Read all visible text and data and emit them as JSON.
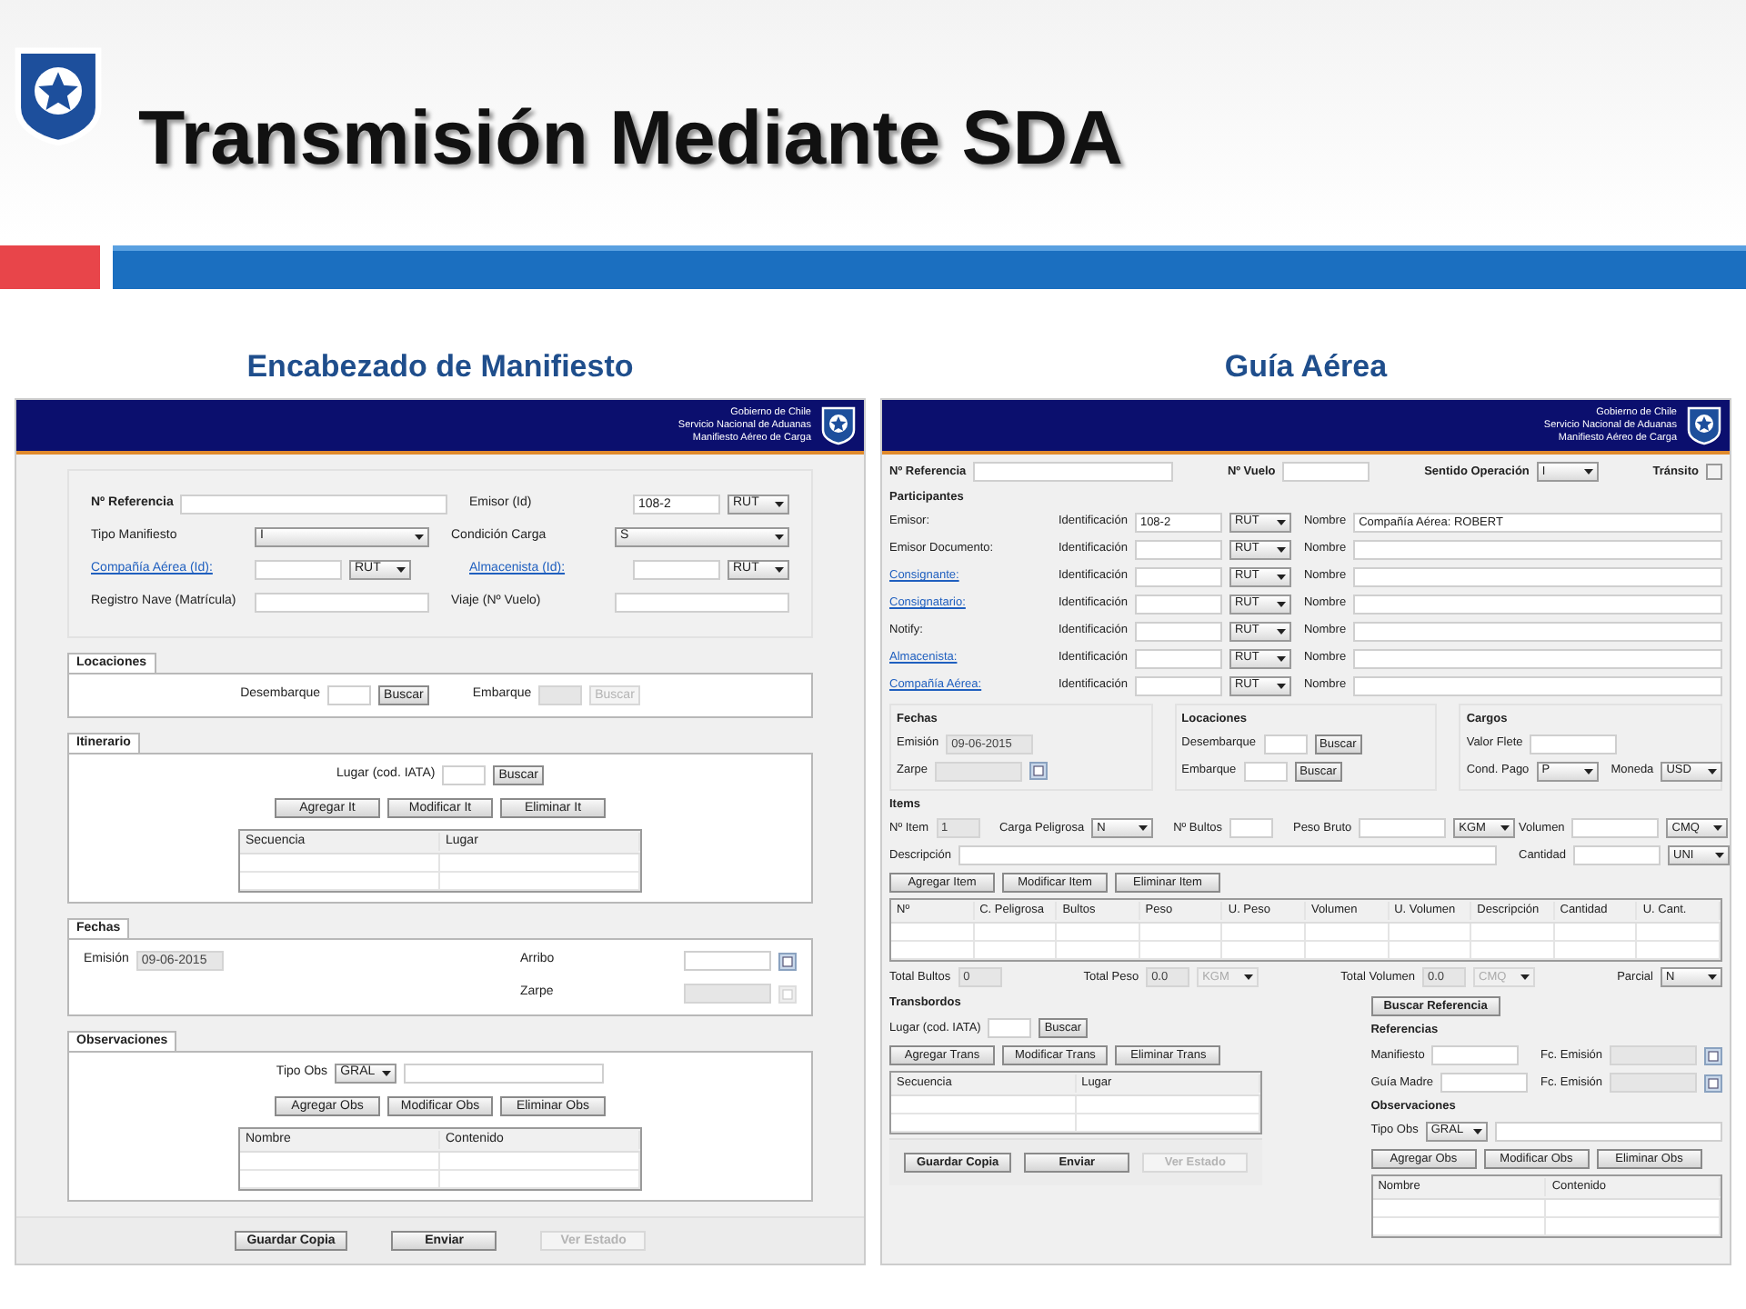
{
  "slide": {
    "title": "Transmisión Mediante SDA"
  },
  "panels": [
    {
      "caption": "Encabezado de Manifiesto",
      "banner": [
        "Gobierno de Chile",
        "Servicio Nacional de Aduanas",
        "Manifiesto Aéreo de Carga"
      ],
      "sections": [
        {
          "kind": "box",
          "rows": [
            [
              [
                {
                  "kind": "bold",
                  "text": "Nº Referencia"
                },
                {
                  "kind": "wide"
                }
              ],
              [
                {
                  "kind": "label",
                  "text": "Emisor (Id)"
                },
                {
                  "kind": "input",
                  "value": "108-2"
                },
                {
                  "kind": "select",
                  "value": "RUT"
                }
              ]
            ],
            [
              [
                {
                  "kind": "label",
                  "text": "Tipo Manifiesto"
                },
                {
                  "kind": "combo",
                  "value": "I"
                }
              ],
              [
                {
                  "kind": "label",
                  "text": "Condición Carga"
                },
                {
                  "kind": "combo",
                  "value": "S"
                }
              ]
            ],
            [
              [
                {
                  "kind": "link",
                  "text": "Compañía Aérea (Id):"
                },
                {
                  "kind": "input"
                },
                {
                  "kind": "select",
                  "value": "RUT"
                }
              ],
              [
                {
                  "kind": "link",
                  "text": "Almacenista (Id):"
                },
                {
                  "kind": "input"
                },
                {
                  "kind": "select",
                  "value": "RUT"
                }
              ]
            ],
            [
              [
                {
                  "kind": "label",
                  "text": "Registro Nave (Matrícula)"
                },
                {
                  "kind": "wide"
                }
              ],
              [
                {
                  "kind": "label",
                  "text": "Viaje (Nº Vuelo)"
                },
                {
                  "kind": "wide"
                }
              ]
            ]
          ]
        },
        {
          "kind": "tab",
          "title": "Locaciones",
          "rows": [
            [
              [
                {
                  "kind": "text",
                  "text": "Desembarque"
                },
                {
                  "kind": "short",
                  "disabled": false
                },
                {
                  "kind": "button",
                  "text": "Buscar",
                  "disabled": false
                }
              ],
              [
                {
                  "kind": "text",
                  "text": "Embarque"
                },
                {
                  "kind": "short",
                  "disabled": true
                },
                {
                  "kind": "button",
                  "text": "Buscar",
                  "disabled": true
                }
              ]
            ]
          ]
        },
        {
          "kind": "tab",
          "title": "Itinerario",
          "rows": [
            [
              [
                {
                  "kind": "text",
                  "text": "Lugar (cod. IATA)"
                },
                {
                  "kind": "short"
                },
                {
                  "kind": "button",
                  "text": "Buscar",
                  "disabled": false
                }
              ]
            ],
            [
              [
                {
                  "kind": "action",
                  "text": "Agregar It",
                  "disabled": false
                },
                {
                  "kind": "action",
                  "text": "Modificar It",
                  "disabled": false
                },
                {
                  "kind": "action",
                  "text": "Eliminar It",
                  "disabled": false
                }
              ]
            ]
          ],
          "table": {
            "columns": [
              "Secuencia",
              "Lugar"
            ]
          }
        },
        {
          "kind": "tab",
          "title": "Fechas",
          "parts": [
            {
              "kind": "plain",
              "rows": [
                [
                  [
                    {
                      "kind": "text",
                      "text": "Emisión"
                    },
                    {
                      "kind": "input",
                      "value": "09-06-2015",
                      "disabled": true
                    }
                  ]
                ]
              ]
            },
            {
              "kind": "plain",
              "rows": [
                [
                  [
                    {
                      "kind": "label",
                      "text": "Arribo"
                    },
                    {
                      "kind": "input",
                      "disabled": false
                    },
                    {
                      "kind": "date",
                      "disabled": false
                    }
                  ]
                ],
                [
                  [
                    {
                      "kind": "label",
                      "text": "Zarpe"
                    },
                    {
                      "kind": "input",
                      "disabled": true
                    },
                    {
                      "kind": "date",
                      "disabled": true
                    }
                  ]
                ]
              ]
            }
          ]
        },
        {
          "kind": "tab",
          "title": "Observaciones",
          "rows": [
            [
              [
                {
                  "kind": "text",
                  "text": "Tipo Obs"
                },
                {
                  "kind": "select",
                  "value": "GRAL"
                },
                {
                  "kind": "long"
                }
              ]
            ],
            [
              [
                {
                  "kind": "action",
                  "text": "Agregar Obs",
                  "disabled": false
                },
                {
                  "kind": "action",
                  "text": "Modificar Obs",
                  "disabled": false
                },
                {
                  "kind": "action",
                  "text": "Eliminar Obs",
                  "disabled": false
                }
              ]
            ]
          ],
          "table": {
            "columns": [
              "Nombre",
              "Contenido"
            ]
          }
        },
        {
          "kind": "footer",
          "rows": [
            [
              [
                {
                  "kind": "action",
                  "text": "Guardar Copia",
                  "bold": true,
                  "disabled": false
                }
              ],
              [
                {
                  "kind": "action",
                  "text": "Enviar",
                  "bold": true,
                  "disabled": false
                }
              ],
              [
                {
                  "kind": "action",
                  "text": "Ver Estado",
                  "bold": true,
                  "disabled": true
                }
              ]
            ]
          ]
        }
      ]
    },
    {
      "caption": "Guía Aérea",
      "banner": [
        "Gobierno de Chile",
        "Servicio Nacional de Aduanas",
        "Manifiesto Aéreo de Carga"
      ],
      "sections": [
        {
          "kind": "plain",
          "rows": [
            [
              [
                {
                  "kind": "bold",
                  "text": "Nº Referencia"
                },
                {
                  "kind": "long"
                }
              ],
              [
                {
                  "kind": "bold",
                  "text": "Nº Vuelo"
                },
                {
                  "kind": "input"
                }
              ],
              [
                {
                  "kind": "bold",
                  "text": "Sentido Operación"
                },
                {
                  "kind": "select",
                  "value": "I"
                }
              ],
              [
                {
                  "kind": "bold",
                  "text": "Tránsito"
                },
                {
                  "kind": "checkbox",
                  "checked": false
                }
              ]
            ]
          ]
        },
        {
          "kind": "heading",
          "title": "Participantes",
          "rows": [
            [
              [
                {
                  "kind": "label",
                  "text": "Emisor:"
                }
              ],
              [
                {
                  "kind": "text",
                  "text": "Identificación"
                },
                {
                  "kind": "input",
                  "value": "108-2"
                },
                {
                  "kind": "select",
                  "value": "RUT"
                }
              ],
              [
                {
                  "kind": "text",
                  "text": "Nombre"
                },
                {
                  "kind": "wide",
                  "value": "Compañía Aérea: ROBERT"
                }
              ]
            ],
            [
              [
                {
                  "kind": "label",
                  "text": "Emisor Documento:"
                }
              ],
              [
                {
                  "kind": "text",
                  "text": "Identificación"
                },
                {
                  "kind": "input"
                },
                {
                  "kind": "select",
                  "value": "RUT"
                }
              ],
              [
                {
                  "kind": "text",
                  "text": "Nombre"
                },
                {
                  "kind": "wide"
                }
              ]
            ],
            [
              [
                {
                  "kind": "link",
                  "text": "Consignante:"
                }
              ],
              [
                {
                  "kind": "text",
                  "text": "Identificación"
                },
                {
                  "kind": "input"
                },
                {
                  "kind": "select",
                  "value": "RUT"
                }
              ],
              [
                {
                  "kind": "text",
                  "text": "Nombre"
                },
                {
                  "kind": "wide"
                }
              ]
            ],
            [
              [
                {
                  "kind": "link",
                  "text": "Consignatario:"
                }
              ],
              [
                {
                  "kind": "text",
                  "text": "Identificación"
                },
                {
                  "kind": "input"
                },
                {
                  "kind": "select",
                  "value": "RUT"
                }
              ],
              [
                {
                  "kind": "text",
                  "text": "Nombre"
                },
                {
                  "kind": "wide"
                }
              ]
            ],
            [
              [
                {
                  "kind": "label",
                  "text": "Notify:"
                }
              ],
              [
                {
                  "kind": "text",
                  "text": "Identificación"
                },
                {
                  "kind": "input"
                },
                {
                  "kind": "select",
                  "value": "RUT"
                }
              ],
              [
                {
                  "kind": "text",
                  "text": "Nombre"
                },
                {
                  "kind": "wide"
                }
              ]
            ],
            [
              [
                {
                  "kind": "link",
                  "text": "Almacenista:"
                }
              ],
              [
                {
                  "kind": "text",
                  "text": "Identificación"
                },
                {
                  "kind": "input"
                },
                {
                  "kind": "select",
                  "value": "RUT"
                }
              ],
              [
                {
                  "kind": "text",
                  "text": "Nombre"
                },
                {
                  "kind": "wide"
                }
              ]
            ],
            [
              [
                {
                  "kind": "link",
                  "text": "Compañía Aérea:"
                }
              ],
              [
                {
                  "kind": "text",
                  "text": "Identificación"
                },
                {
                  "kind": "input"
                },
                {
                  "kind": "select",
                  "value": "RUT"
                }
              ],
              [
                {
                  "kind": "text",
                  "text": "Nombre"
                },
                {
                  "kind": "wide"
                }
              ]
            ]
          ]
        },
        {
          "kind": "plain",
          "parts": [
            {
              "kind": "heading",
              "title": "Fechas",
              "rows": [
                [
                  [
                    {
                      "kind": "text",
                      "text": "Emisión"
                    },
                    {
                      "kind": "input",
                      "value": "09-06-2015",
                      "disabled": true
                    }
                  ]
                ],
                [
                  [
                    {
                      "kind": "text",
                      "text": "Zarpe"
                    },
                    {
                      "kind": "input",
                      "disabled": true
                    },
                    {
                      "kind": "date",
                      "disabled": false
                    }
                  ]
                ]
              ]
            },
            {
              "kind": "heading",
              "title": "Locaciones",
              "rows": [
                [
                  [
                    {
                      "kind": "text",
                      "text": "Desembarque"
                    },
                    {
                      "kind": "short"
                    },
                    {
                      "kind": "button",
                      "text": "Buscar",
                      "disabled": false
                    }
                  ]
                ],
                [
                  [
                    {
                      "kind": "text",
                      "text": "Embarque"
                    },
                    {
                      "kind": "short"
                    },
                    {
                      "kind": "button",
                      "text": "Buscar",
                      "disabled": false
                    }
                  ]
                ]
              ]
            },
            {
              "kind": "heading",
              "title": "Cargos",
              "rows": [
                [
                  [
                    {
                      "kind": "text",
                      "text": "Valor Flete"
                    },
                    {
                      "kind": "input"
                    }
                  ]
                ],
                [
                  [
                    {
                      "kind": "text",
                      "text": "Cond. Pago"
                    },
                    {
                      "kind": "select",
                      "value": "P"
                    }
                  ],
                  [
                    {
                      "kind": "text",
                      "text": "Moneda"
                    },
                    {
                      "kind": "select",
                      "value": "USD"
                    }
                  ]
                ]
              ]
            }
          ]
        },
        {
          "kind": "heading",
          "title": "Items",
          "parts": [
            {
              "kind": "plain",
              "rows": [
                [
                  [
                    {
                      "kind": "text",
                      "text": "Nº Item"
                    },
                    {
                      "kind": "short",
                      "value": "1",
                      "disabled": true
                    }
                  ],
                  [
                    {
                      "kind": "text",
                      "text": "Carga Peligrosa"
                    },
                    {
                      "kind": "select",
                      "value": "N"
                    }
                  ],
                  [
                    {
                      "kind": "text",
                      "text": "Nº Bultos"
                    },
                    {
                      "kind": "short"
                    }
                  ],
                  [
                    {
                      "kind": "text",
                      "text": "Peso Bruto"
                    },
                    {
                      "kind": "input"
                    },
                    {
                      "kind": "select",
                      "value": "KGM"
                    }
                  ]
                ],
                [
                  [
                    {
                      "kind": "text",
                      "text": "Descripción"
                    },
                    {
                      "kind": "wide"
                    }
                  ]
                ]
              ]
            },
            {
              "kind": "plain",
              "rows": [
                [
                  [
                    {
                      "kind": "text",
                      "text": "Volumen"
                    },
                    {
                      "kind": "input"
                    },
                    {
                      "kind": "select",
                      "value": "CMQ"
                    }
                  ]
                ],
                [
                  [
                    {
                      "kind": "text",
                      "text": "Cantidad"
                    },
                    {
                      "kind": "input"
                    },
                    {
                      "kind": "select",
                      "value": "UNI"
                    }
                  ]
                ]
              ]
            }
          ],
          "rows": [
            [
              [
                {
                  "kind": "action",
                  "text": "Agregar Item",
                  "disabled": false
                },
                {
                  "kind": "action",
                  "text": "Modificar Item",
                  "disabled": false
                },
                {
                  "kind": "action",
                  "text": "Eliminar Item",
                  "disabled": false
                }
              ]
            ]
          ],
          "table": {
            "columns": [
              "Nº",
              "C. Peligrosa",
              "Bultos",
              "Peso",
              "U. Peso",
              "Volumen",
              "U. Volumen",
              "Descripción",
              "Cantidad",
              "U. Cant."
            ]
          },
          "after": [
            [
              [
                {
                  "kind": "text",
                  "text": "Total Bultos"
                },
                {
                  "kind": "short",
                  "value": "0",
                  "disabled": true
                }
              ],
              [
                {
                  "kind": "text",
                  "text": "Total Peso"
                },
                {
                  "kind": "short",
                  "value": "0.0",
                  "disabled": true
                },
                {
                  "kind": "select",
                  "value": "KGM",
                  "disabled": true
                }
              ],
              [
                {
                  "kind": "text",
                  "text": "Total Volumen"
                },
                {
                  "kind": "short",
                  "value": "0.0",
                  "disabled": true
                },
                {
                  "kind": "select",
                  "value": "CMQ",
                  "disabled": true
                }
              ],
              [
                {
                  "kind": "text",
                  "text": "Parcial"
                },
                {
                  "kind": "select",
                  "value": "N"
                }
              ]
            ]
          ]
        },
        {
          "kind": "plain",
          "parts": [
            {
              "kind": "plain",
              "sections": [
                {
                  "kind": "heading",
                  "title": "Transbordos",
                  "rows": [
                    [
                      [
                        {
                          "kind": "text",
                          "text": "Lugar (cod. IATA)"
                        },
                        {
                          "kind": "short"
                        },
                        {
                          "kind": "button",
                          "text": "Buscar",
                          "disabled": false
                        }
                      ]
                    ],
                    [
                      [
                        {
                          "kind": "action",
                          "text": "Agregar Trans",
                          "disabled": false
                        },
                        {
                          "kind": "action",
                          "text": "Modificar Trans",
                          "disabled": false
                        },
                        {
                          "kind": "action",
                          "text": "Eliminar Trans",
                          "disabled": false
                        }
                      ]
                    ]
                  ],
                  "table": {
                    "columns": [
                      "Secuencia",
                      "Lugar"
                    ]
                  }
                },
                {
                  "kind": "footer",
                  "rows": [
                    [
                      [
                        {
                          "kind": "action",
                          "text": "Guardar Copia",
                          "bold": true,
                          "disabled": false
                        }
                      ],
                      [
                        {
                          "kind": "action",
                          "text": "Enviar",
                          "bold": true,
                          "disabled": false
                        }
                      ],
                      [
                        {
                          "kind": "action",
                          "text": "Ver Estado",
                          "bold": true,
                          "disabled": true
                        }
                      ]
                    ]
                  ]
                }
              ]
            },
            {
              "kind": "plain",
              "sections": [
                {
                  "kind": "plain",
                  "rows": [
                    [
                      [
                        {
                          "kind": "action",
                          "text": "Buscar Referencia",
                          "bold": true,
                          "disabled": false
                        }
                      ]
                    ]
                  ]
                },
                {
                  "kind": "heading",
                  "title": "Referencias",
                  "rows": [
                    [
                      [
                        {
                          "kind": "text",
                          "text": "Manifiesto"
                        },
                        {
                          "kind": "input"
                        }
                      ],
                      [
                        {
                          "kind": "text",
                          "text": "Fc. Emisión"
                        },
                        {
                          "kind": "input",
                          "disabled": true
                        },
                        {
                          "kind": "date",
                          "disabled": false
                        }
                      ]
                    ],
                    [
                      [
                        {
                          "kind": "text",
                          "text": "Guía Madre"
                        },
                        {
                          "kind": "input"
                        }
                      ],
                      [
                        {
                          "kind": "text",
                          "text": "Fc. Emisión"
                        },
                        {
                          "kind": "input",
                          "disabled": true
                        },
                        {
                          "kind": "date",
                          "disabled": false
                        }
                      ]
                    ]
                  ]
                },
                {
                  "kind": "heading",
                  "title": "Observaciones",
                  "rows": [
                    [
                      [
                        {
                          "kind": "text",
                          "text": "Tipo Obs"
                        },
                        {
                          "kind": "select",
                          "value": "GRAL"
                        },
                        {
                          "kind": "wide"
                        }
                      ]
                    ],
                    [
                      [
                        {
                          "kind": "action",
                          "text": "Agregar Obs",
                          "disabled": false
                        },
                        {
                          "kind": "action",
                          "text": "Modificar Obs",
                          "disabled": false
                        },
                        {
                          "kind": "action",
                          "text": "Eliminar Obs",
                          "disabled": false
                        }
                      ]
                    ]
                  ],
                  "table": {
                    "columns": [
                      "Nombre",
                      "Contenido"
                    ]
                  }
                }
              ]
            }
          ]
        }
      ]
    }
  ]
}
